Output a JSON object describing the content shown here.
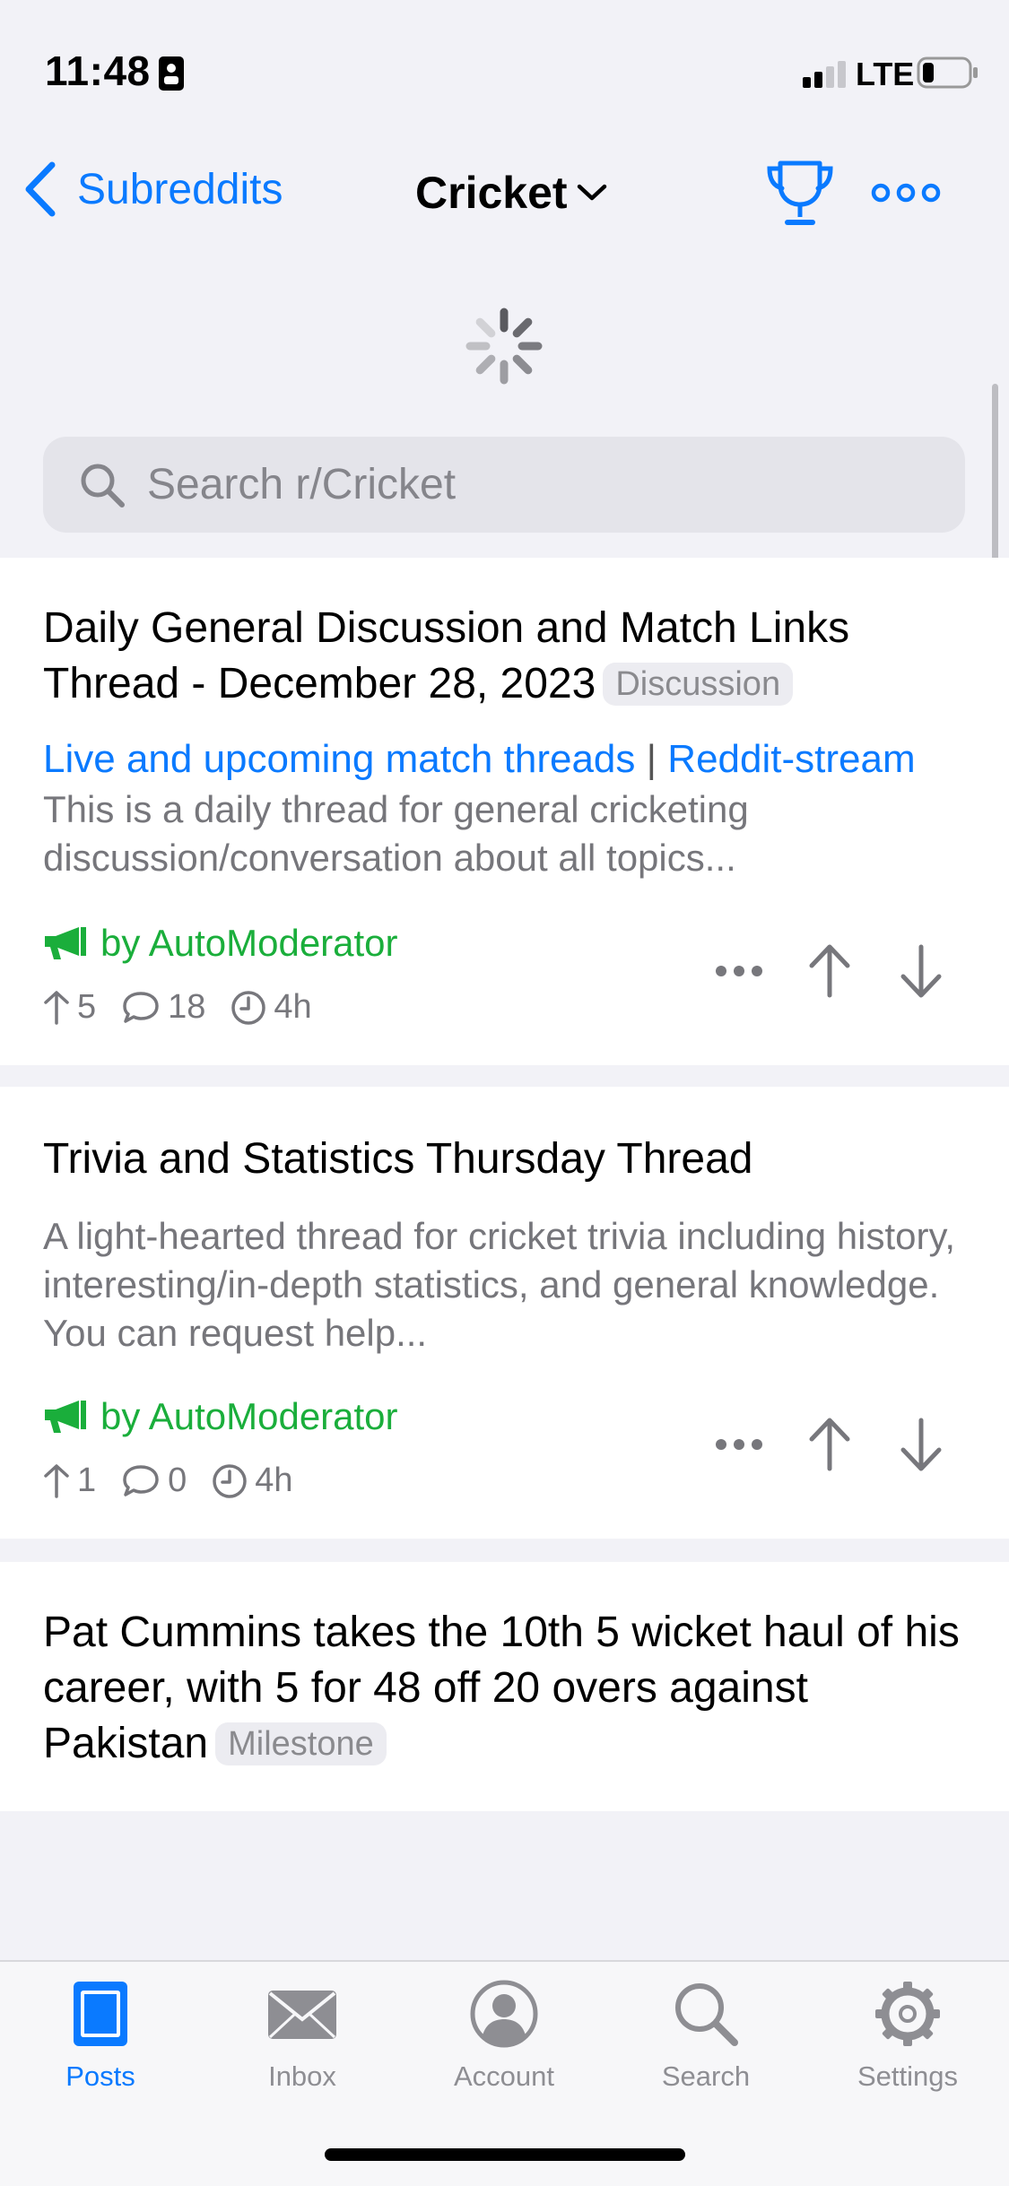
{
  "status_bar": {
    "time": "11:48",
    "network": "LTE"
  },
  "nav": {
    "back_label": "Subreddits",
    "title": "Cricket"
  },
  "search": {
    "placeholder": "Search r/Cricket"
  },
  "posts": [
    {
      "title": "Daily General Discussion and Match Links Thread - December 28, 2023",
      "flair": "Discussion",
      "link1": "Live and upcoming match threads",
      "link_sep": "|",
      "link2": "Reddit-stream",
      "body": "This is a daily thread for general cricketing discussion/conversation about all topics...",
      "author": "by AutoModerator",
      "upvotes": "5",
      "comments": "18",
      "age": "4h"
    },
    {
      "title": "Trivia and Statistics Thursday Thread",
      "body": "A light-hearted thread for cricket trivia including history, interesting/in-depth statistics, and general knowledge. You can request help...",
      "author": "by AutoModerator",
      "upvotes": "1",
      "comments": "0",
      "age": "4h"
    },
    {
      "title": "Pat Cummins takes the 10th 5 wicket haul of his career, with 5 for 48 off 20 overs against Pakistan",
      "flair": "Milestone"
    }
  ],
  "tabs": [
    {
      "label": "Posts",
      "icon": "posts-icon"
    },
    {
      "label": "Inbox",
      "icon": "inbox-icon"
    },
    {
      "label": "Account",
      "icon": "account-icon"
    },
    {
      "label": "Search",
      "icon": "search-icon"
    },
    {
      "label": "Settings",
      "icon": "gear-icon"
    }
  ],
  "colors": {
    "accent": "#0a7aff",
    "moderator": "#1aae3b",
    "background": "#f2f2f7"
  }
}
